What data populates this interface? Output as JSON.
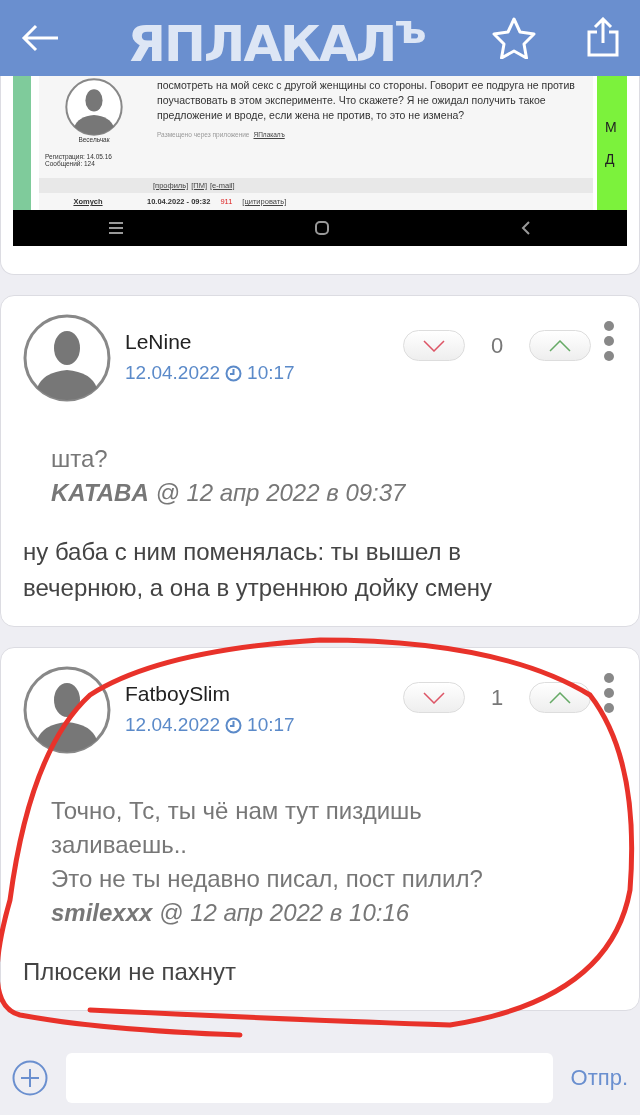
{
  "header": {
    "logo": "ЯПЛАКАЛ$^{ъ}$"
  },
  "embedded_screenshot": {
    "user_rank": "Весельчак",
    "registration": "Регистрация: 14.05.16",
    "posts": "Сообщений: 124",
    "text": "посмотреть на мой секс с другой женщины со стороны. Говорит ее подруга не против поучаствовать в этом эксперименте. Что скажете? Я не ожидал получить такое предложение и вроде, если жена не против, то это не измена?",
    "posted_via": "Размещено через приложение",
    "app_link": "ЯПлакалъ",
    "links": [
      "[профиль]",
      "[ПМ]",
      "[e-mail]"
    ],
    "next_author": "Xomych",
    "next_date": "10.04.2022 - 09:32",
    "next_rating": "911",
    "quote_link": "[цитировать]",
    "side_letters": [
      "М",
      "Д"
    ]
  },
  "comments": [
    {
      "author": "LeNine",
      "date": "12.04.2022",
      "time": "10:17",
      "votes": "0",
      "quote": {
        "lines": [
          "шта?"
        ],
        "author": "KATABA",
        "when": "@ 12 апр 2022 в 09:37"
      },
      "body": "ну баба с ним поменялась: ты вышел в вечернюю, а она в утреннюю дойку смену"
    },
    {
      "author": "FatboySlim",
      "date": "12.04.2022",
      "time": "10:17",
      "votes": "1",
      "quote": {
        "lines": [
          "Точно, Тс, ты чё нам тут пиздишь заливаешь..",
          "Это не ты недавно писал, пост пилил?"
        ],
        "author": "smilexxx",
        "when": "@ 12 апр 2022 в 10:16"
      },
      "body": "Плюсеки не пахнут"
    }
  ],
  "composer": {
    "send": "Отпр."
  }
}
